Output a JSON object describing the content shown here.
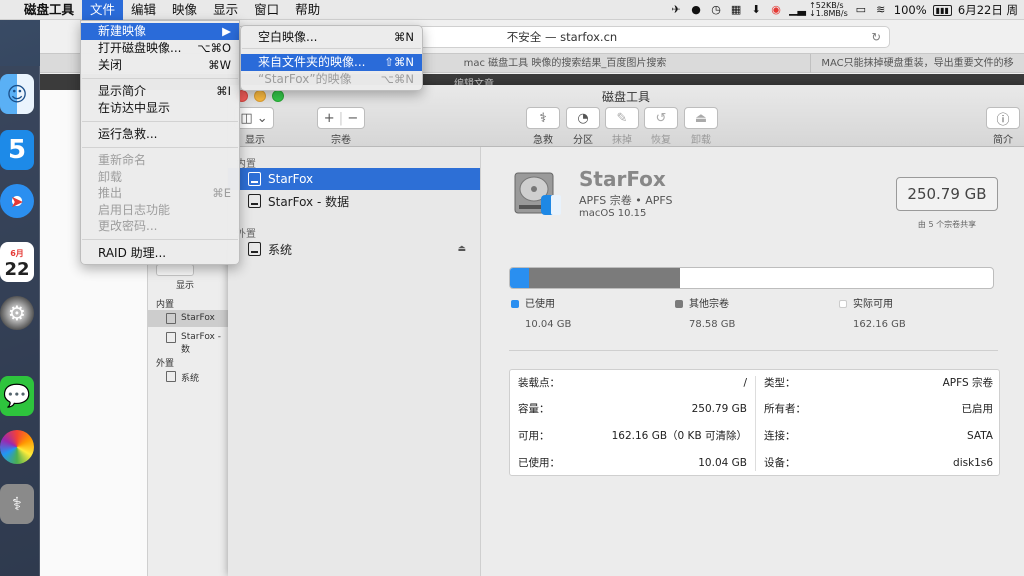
{
  "menubar": {
    "app_name": "磁盘工具",
    "menus": [
      "文件",
      "编辑",
      "映像",
      "显示",
      "窗口",
      "帮助"
    ],
    "net_up": "↑52KB/s",
    "net_down": "↓1.8MB/s",
    "battery": "100%",
    "date": "6月22日 周"
  },
  "file_menu": {
    "items": [
      {
        "label": "新建映像",
        "shortcut": "▶"
      },
      {
        "label": "打开磁盘映像...",
        "shortcut": "⌥⌘O"
      },
      {
        "label": "关闭",
        "shortcut": "⌘W"
      },
      {
        "label": "显示简介",
        "shortcut": "⌘I"
      },
      {
        "label": "在访达中显示",
        "shortcut": ""
      },
      {
        "label": "运行急救...",
        "shortcut": ""
      },
      {
        "label": "重新命名",
        "shortcut": ""
      },
      {
        "label": "卸载",
        "shortcut": ""
      },
      {
        "label": "推出",
        "shortcut": "⌘E"
      },
      {
        "label": "启用日志功能",
        "shortcut": ""
      },
      {
        "label": "更改密码...",
        "shortcut": ""
      },
      {
        "label": "RAID 助理...",
        "shortcut": ""
      }
    ]
  },
  "sub_menu": {
    "items": [
      {
        "label": "空白映像...",
        "shortcut": "⌘N"
      },
      {
        "label": "来自文件夹的映像...",
        "shortcut": "⇧⌘N"
      },
      {
        "label": "“StarFox”的映像",
        "shortcut": "⌥⌘N"
      }
    ]
  },
  "browser": {
    "url": "不安全 — starfox.cn",
    "tabs": [
      "mac 磁盘工具 映像的搜索结果_百度图片搜索",
      "MAC只能抹掉硬盘重装，导出重要文件的移"
    ],
    "page_strip_text": "编辑文章"
  },
  "disk_utility": {
    "title": "磁盘工具",
    "toolbar": {
      "view": "显示",
      "volume": "宗卷",
      "first_aid": "急救",
      "partition": "分区",
      "erase": "抹掉",
      "restore": "恢复",
      "unmount": "卸载",
      "info": "简介"
    },
    "sidebar": {
      "internal": "内置",
      "external": "外置",
      "items": [
        "StarFox",
        "StarFox - 数据",
        "系统"
      ]
    },
    "volume": {
      "name": "StarFox",
      "type": "APFS 宗卷 • APFS",
      "os": "macOS 10.15",
      "size": "250.79 GB",
      "shared": "由 5 个宗卷共享"
    },
    "usage": {
      "used_label": "已使用",
      "used_value": "10.04 GB",
      "used_fraction": 0.04,
      "other_label": "其他宗卷",
      "other_value": "78.58 GB",
      "other_fraction": 0.313,
      "free_label": "实际可用",
      "free_value": "162.16 GB"
    },
    "info": {
      "mount_label": "装载点：",
      "mount_value": "/",
      "capacity_label": "容量：",
      "capacity_value": "250.79 GB",
      "available_label": "可用：",
      "available_value": "162.16 GB（0 KB 可清除）",
      "used_label": "已使用：",
      "used_value": "10.04 GB",
      "type_label": "类型：",
      "type_value": "APFS 宗卷",
      "owner_label": "所有者：",
      "owner_value": "已启用",
      "connection_label": "连接：",
      "connection_value": "SATA",
      "device_label": "设备：",
      "device_value": "disk1s6"
    }
  },
  "small_du": {
    "view": "显示",
    "internal": "内置",
    "item1": "StarFox",
    "item2": "StarFox - 数",
    "external": "外置",
    "item3": "系统"
  },
  "dock": {
    "calendar_month": "6月",
    "calendar_day": "22"
  },
  "colors": {
    "accent": "#2a6bd9",
    "used": "#2a8ff0",
    "other": "#7b7b7b"
  }
}
